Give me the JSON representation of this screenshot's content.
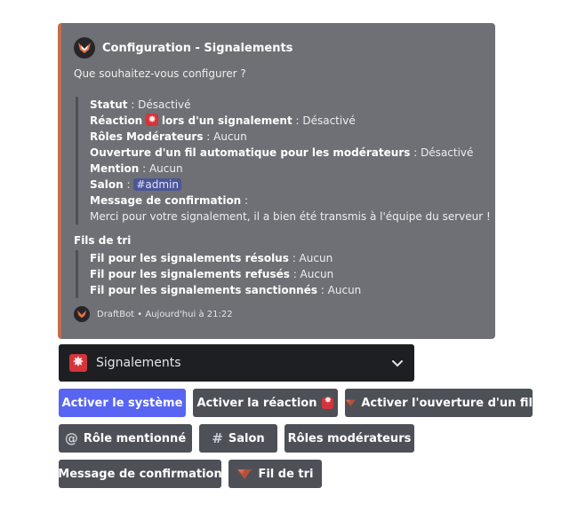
{
  "embed": {
    "author": "Configuration - Signalements",
    "description": "Que souhaitez-vous configurer ?",
    "config": {
      "status_key": "Statut",
      "status_sep": " : ",
      "status_val": "Désactivé",
      "reaction_key1": "Réaction",
      "reaction_key2": "lors d'un signalement",
      "reaction_sep": " : ",
      "reaction_val": "Désactivé",
      "roles_key": "Rôles Modérateurs",
      "roles_sep": " : ",
      "roles_val": "Aucun",
      "thread_key": "Ouverture d'un fil automatique pour les modérateurs",
      "thread_sep": " : ",
      "thread_val": "Désactivé",
      "mention_key": "Mention",
      "mention_sep": " : ",
      "mention_val": "Aucun",
      "channel_key": "Salon",
      "channel_sep": " : ",
      "channel_hash": "#",
      "channel_val": "admin",
      "confirm_key": "Message de confirmation",
      "confirm_sep": " :",
      "confirm_val": "Merci pour votre signalement, il a bien été transmis à l'équipe du serveur !"
    },
    "sort_title": "Fils de tri",
    "sort": {
      "resolved_key": "Fil pour les signalements résolus",
      "resolved_sep": " : ",
      "resolved_val": "Aucun",
      "refused_key": "Fil pour les signalements refusés",
      "refused_sep": " : ",
      "refused_val": "Aucun",
      "sanctioned_key": "Fil pour les signalements sanctionnés",
      "sanctioned_sep": " : ",
      "sanctioned_val": "Aucun"
    },
    "footer": "DraftBot • Aujourd'hui à 21:22"
  },
  "select": {
    "label": "Signalements",
    "icon": "alarm-light-icon"
  },
  "buttons": {
    "enable_system": "Activer le système",
    "enable_reaction": "Activer la réaction",
    "enable_thread": "Activer l'ouverture d'un fil",
    "mention_role": "Rôle mentionné",
    "channel": "Salon",
    "mod_roles": "Rôles modérateurs",
    "confirm_message": "Message de confirmation",
    "sort_thread": "Fil de tri"
  },
  "colors": {
    "accent": "#5865f2",
    "embed_border": "#c26e4d",
    "embed_bg": "#6f7075",
    "button": "#4e5058",
    "select_bg": "#1e1f22"
  }
}
